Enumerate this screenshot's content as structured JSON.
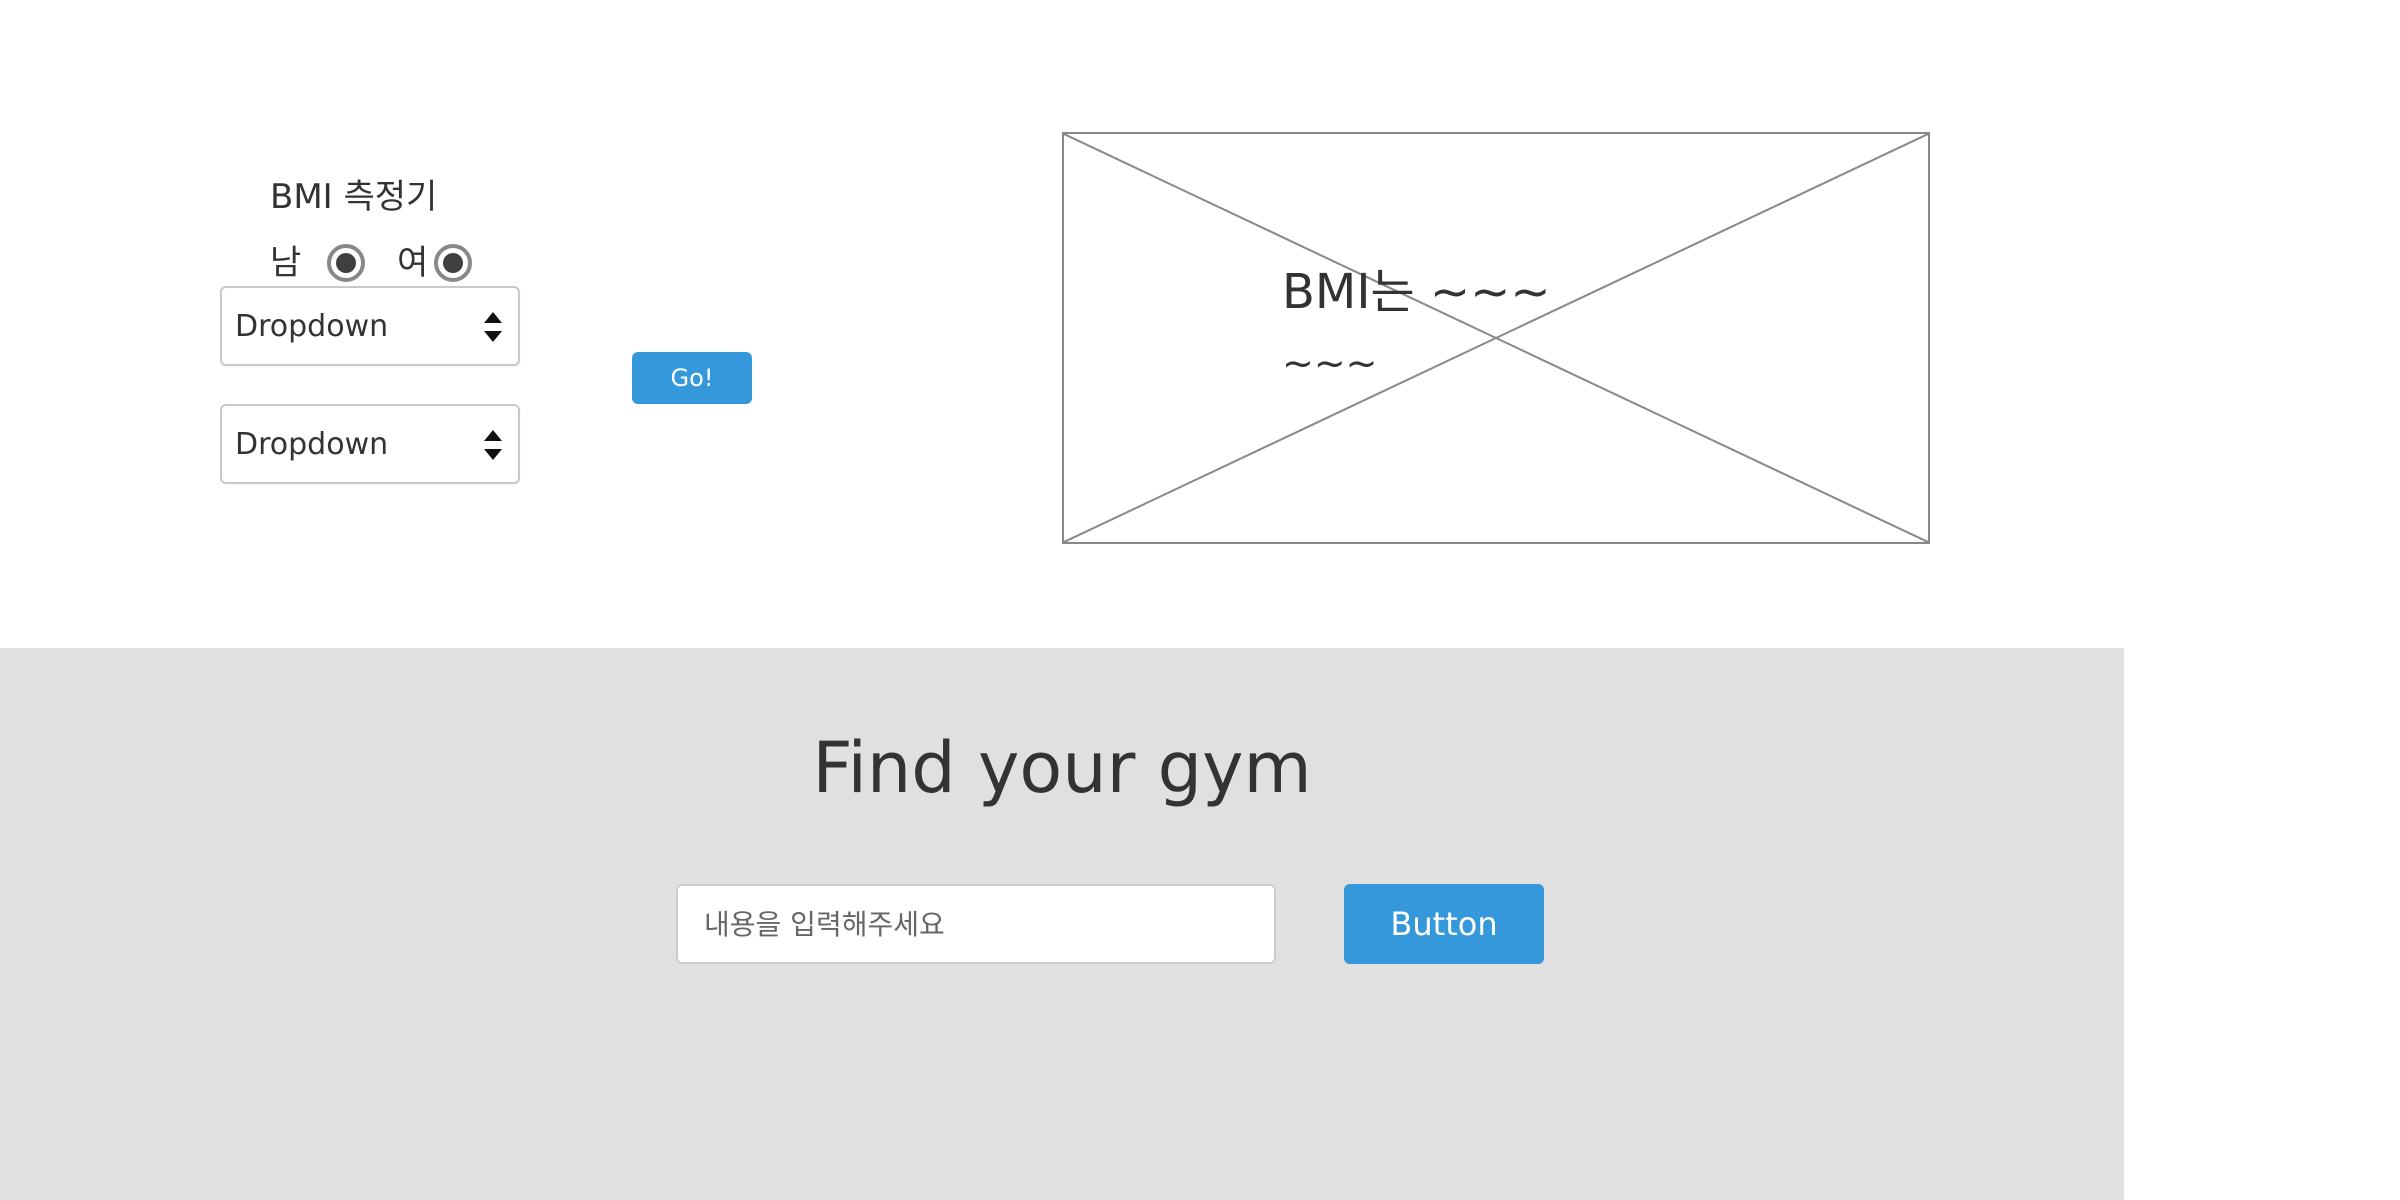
{
  "bmi": {
    "title": "BMI 측정기",
    "gender": {
      "male_label": "남",
      "female_label": "여"
    },
    "dropdowns": [
      {
        "selected": "Dropdown"
      },
      {
        "selected": "Dropdown"
      }
    ],
    "go_label": "Go!"
  },
  "result": {
    "text": "BMI는 ~~~",
    "subtext": "~~~"
  },
  "gym": {
    "title": "Find your gym",
    "search_placeholder": "내용을 입력해주세요",
    "button_label": "Button"
  },
  "icons": {
    "dropdown_arrows": "chevron-up-down-icon",
    "image_placeholder": "image-placeholder-icon"
  },
  "colors": {
    "accent": "#3498db",
    "section_background": "#e0e0e0",
    "text": "#333333",
    "placeholder_stroke": "#888888"
  }
}
